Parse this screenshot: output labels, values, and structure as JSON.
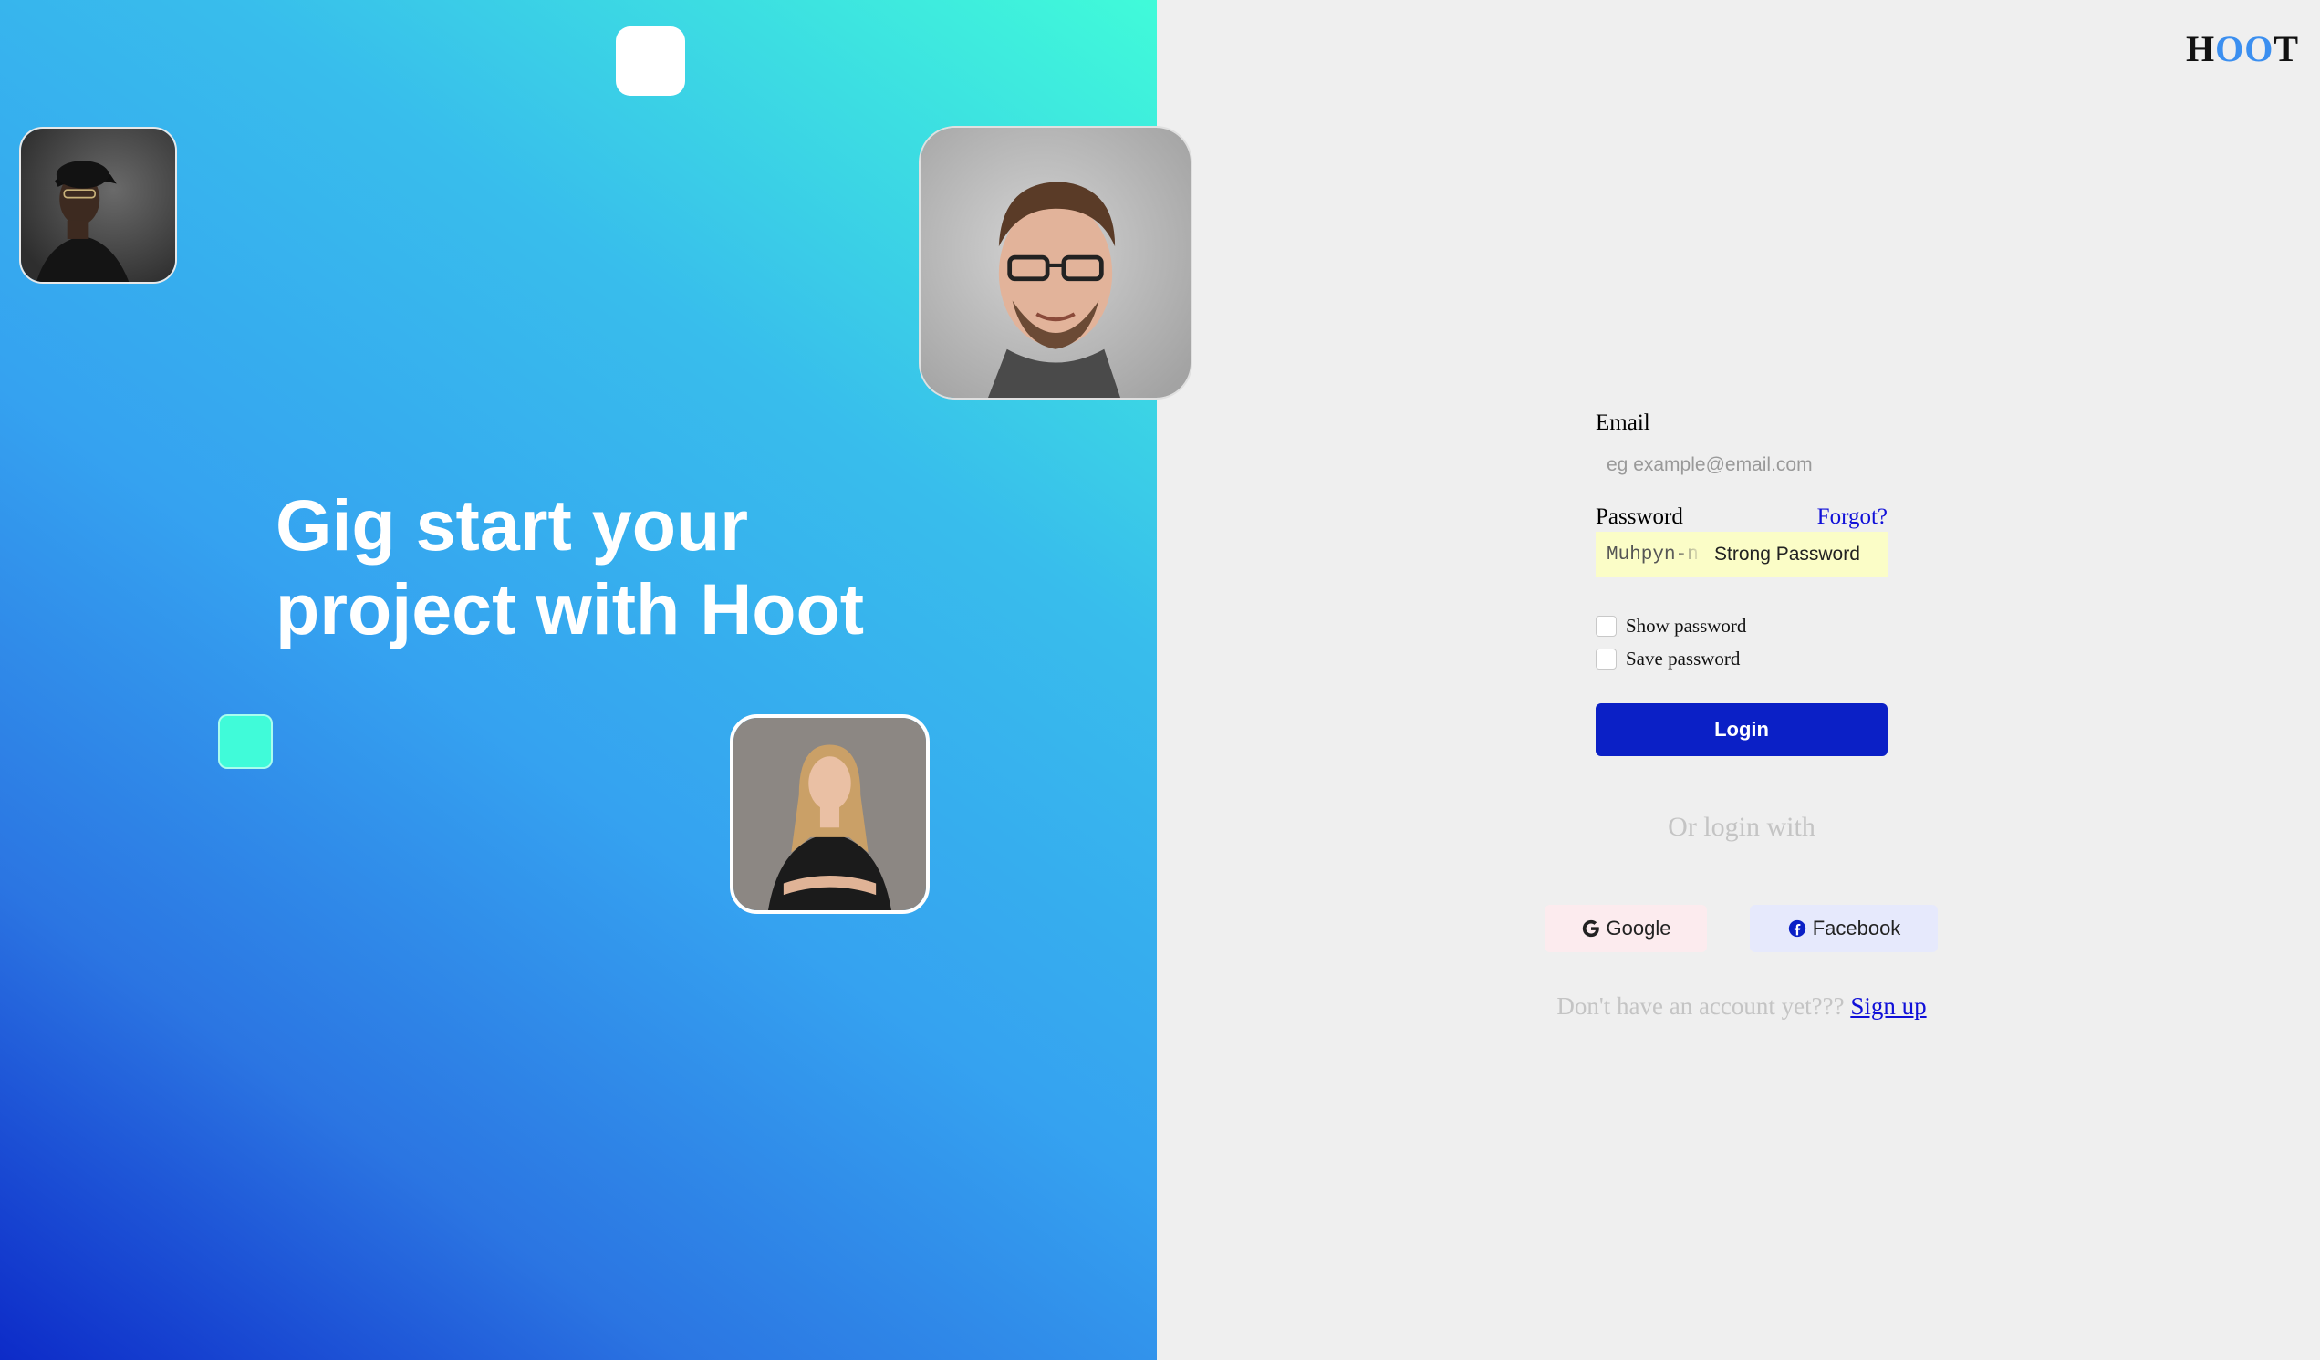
{
  "hero": {
    "title_line1": "Gig start your",
    "title_line2": "project with Hoot"
  },
  "logo": {
    "part1": "H",
    "part2": "OO",
    "part3": "T"
  },
  "login": {
    "email_label": "Email",
    "email_placeholder": "eg example@email.com",
    "password_label": "Password",
    "forgot_label": "Forgot?",
    "password_value": "Muhpyn-n",
    "password_strength": "Strong Password",
    "show_password_label": "Show password",
    "save_password_label": "Save password",
    "login_button": "Login",
    "or_login_with": "Or login with",
    "google_label": "Google",
    "facebook_label": "Facebook",
    "signup_prompt": "Don't have an account yet???",
    "signup_link": "Sign up"
  },
  "colors": {
    "primary": "#0b20c6",
    "link": "#1010d8",
    "accent_teal": "#40fbd9",
    "panel_bg": "#efefef"
  },
  "icons": {
    "google": "google-icon",
    "facebook": "facebook-icon"
  }
}
